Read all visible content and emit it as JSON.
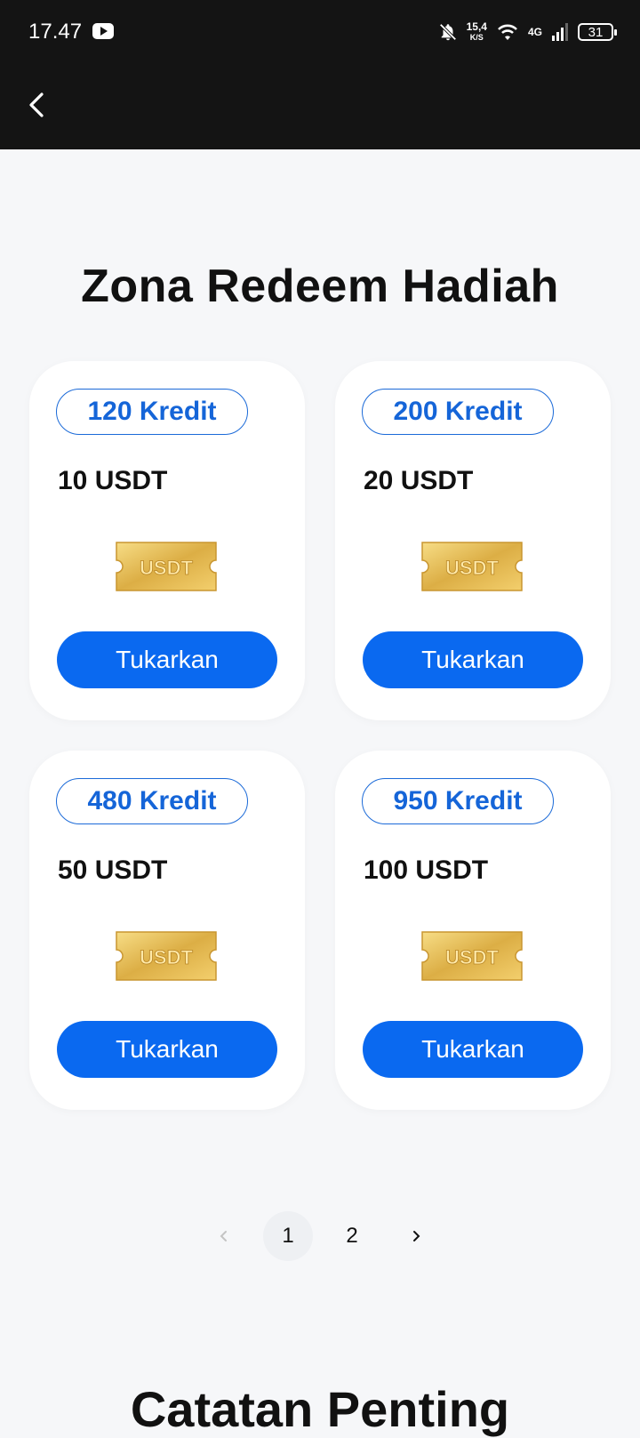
{
  "status_bar": {
    "time": "17.47",
    "speed_value": "15,4",
    "speed_unit": "K/S",
    "network": "4G",
    "battery": "31"
  },
  "page_title": "Zona Redeem Hadiah",
  "rewards": [
    {
      "credits": "120 Kredit",
      "amount": "10 USDT",
      "button": "Tukarkan"
    },
    {
      "credits": "200 Kredit",
      "amount": "20 USDT",
      "button": "Tukarkan"
    },
    {
      "credits": "480 Kredit",
      "amount": "50 USDT",
      "button": "Tukarkan"
    },
    {
      "credits": "950 Kredit",
      "amount": "100 USDT",
      "button": "Tukarkan"
    }
  ],
  "ticket_label": "USDT",
  "pagination": {
    "pages": [
      "1",
      "2"
    ],
    "current": "1"
  },
  "notes_title": "Catatan Penting",
  "colors": {
    "accent": "#0a69f0",
    "topbar": "#141414",
    "background": "#f6f7f9"
  }
}
